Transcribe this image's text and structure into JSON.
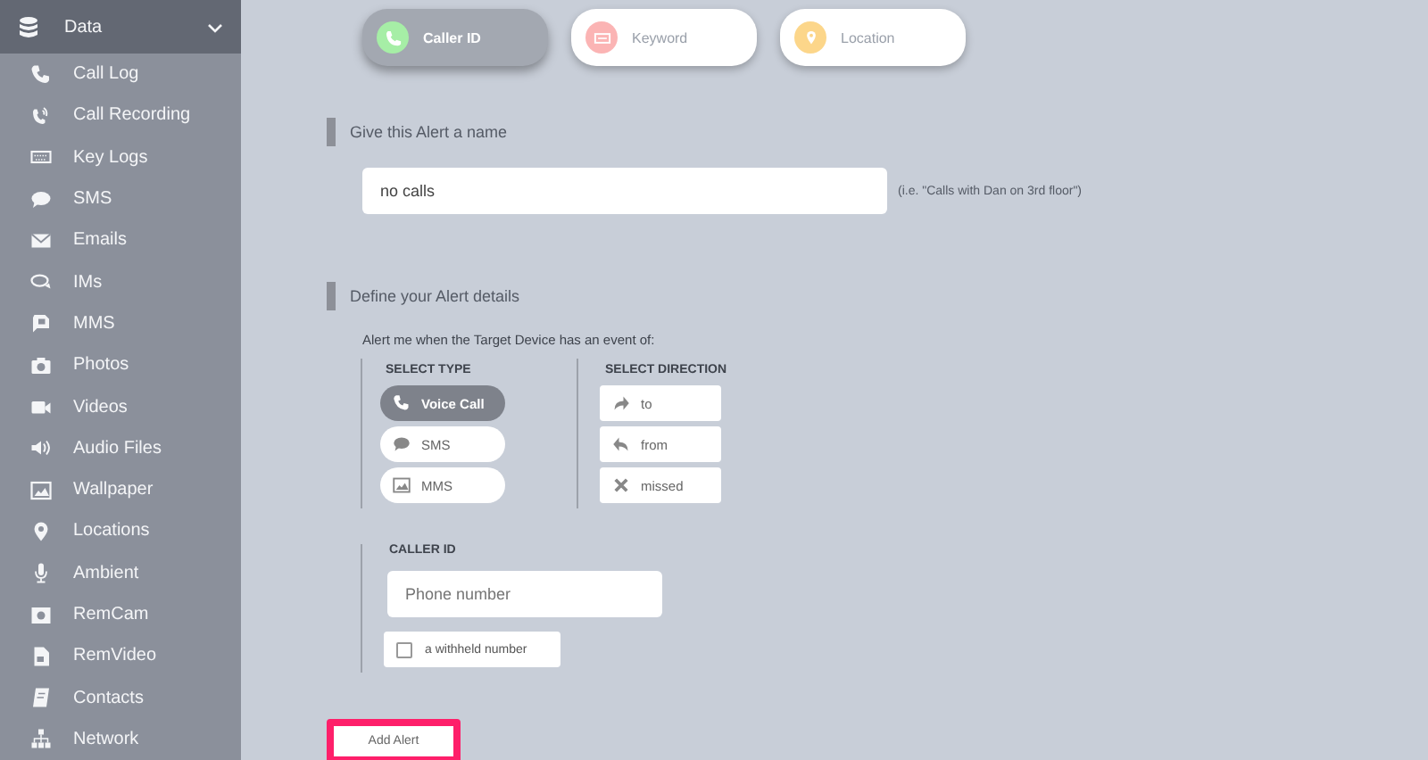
{
  "sidebar": {
    "header": {
      "label": "Data",
      "expanded": true
    },
    "items": [
      {
        "label": "Call Log"
      },
      {
        "label": "Call Recording"
      },
      {
        "label": "Key Logs"
      },
      {
        "label": "SMS"
      },
      {
        "label": "Emails"
      },
      {
        "label": "IMs"
      },
      {
        "label": "MMS"
      },
      {
        "label": "Photos"
      },
      {
        "label": "Videos"
      },
      {
        "label": "Audio Files"
      },
      {
        "label": "Wallpaper"
      },
      {
        "label": "Locations"
      },
      {
        "label": "Ambient"
      },
      {
        "label": "RemCam"
      },
      {
        "label": "RemVideo"
      },
      {
        "label": "Contacts"
      },
      {
        "label": "Network"
      }
    ]
  },
  "alert_tabs": [
    {
      "label": "Caller ID",
      "selected": true,
      "color": "#a6eea6"
    },
    {
      "label": "Keyword",
      "selected": false,
      "color": "#fbb4b4"
    },
    {
      "label": "Location",
      "selected": false,
      "color": "#fcd68a"
    }
  ],
  "name_section": {
    "heading": "Give this Alert a name",
    "value": "no calls",
    "hint": "(i.e. \"Calls with Dan on 3rd floor\")"
  },
  "details_section": {
    "heading": "Define your Alert details",
    "intro": "Alert me when the Target Device has an event of:",
    "type_label": "SELECT TYPE",
    "types": [
      {
        "label": "Voice Call",
        "selected": true
      },
      {
        "label": "SMS",
        "selected": false
      },
      {
        "label": "MMS",
        "selected": false
      }
    ],
    "direction_label": "SELECT DIRECTION",
    "directions": [
      {
        "label": "to",
        "selected": false
      },
      {
        "label": "from",
        "selected": false
      },
      {
        "label": "missed",
        "selected": false
      }
    ],
    "caller_id_label": "CALLER ID",
    "phone_placeholder": "Phone number",
    "withheld": {
      "label": "a withheld number",
      "checked": false
    }
  },
  "submit": "Add Alert"
}
